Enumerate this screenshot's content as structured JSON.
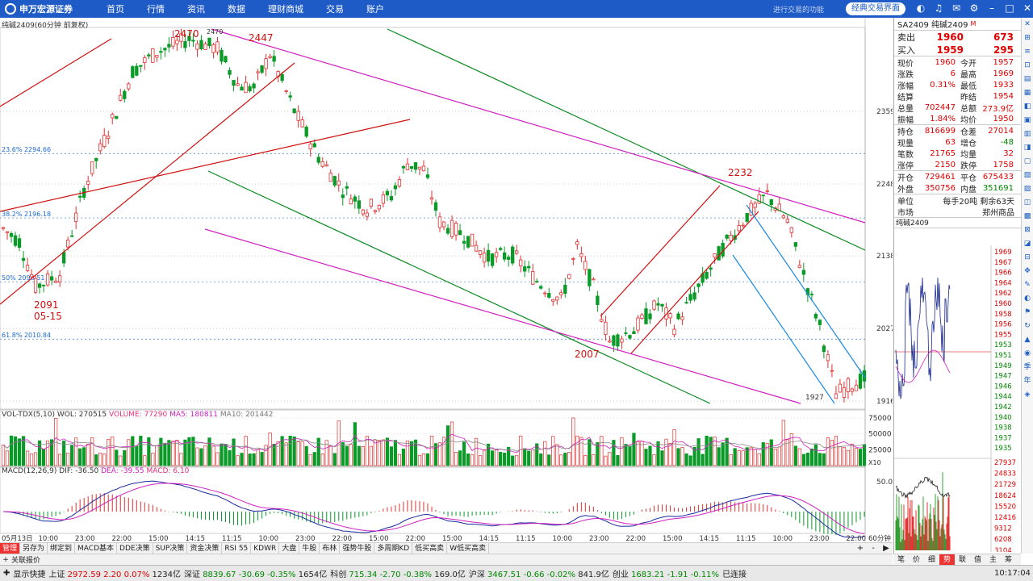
{
  "app": {
    "logo_text": "申万宏源证券"
  },
  "menu": [
    "首页",
    "行情",
    "资讯",
    "数据",
    "理财商城",
    "交易",
    "账户"
  ],
  "top_right": {
    "login_hint": "进行交易的功能",
    "classic_label": "经典交易界面"
  },
  "chart": {
    "title": "纯碱2409(60分钟 前复权)",
    "price_ticks": [
      {
        "v": 2359,
        "label": "2359"
      },
      {
        "v": 2248,
        "label": "2248"
      },
      {
        "v": 2138,
        "label": "2138"
      },
      {
        "v": 2027,
        "label": "2027"
      },
      {
        "v": 1916,
        "label": "1916"
      }
    ],
    "fib_levels": [
      {
        "v": 2294.66,
        "label": "23.6% 2294.66"
      },
      {
        "v": 2196.18,
        "label": "38.2% 2196.18"
      },
      {
        "v": 2098.51,
        "label": "50% 2098.51"
      },
      {
        "v": 2010.84,
        "label": "61.8% 2010.84"
      }
    ],
    "annotations": [
      {
        "text": "2470",
        "v": 2470,
        "i": 46
      },
      {
        "text": "2470",
        "v": 2470,
        "i": 53
      },
      {
        "text": "2447",
        "v": 2447,
        "i": 66
      },
      {
        "text": "2091",
        "v": 2091,
        "i": 8
      },
      {
        "text": "05-15",
        "v": 2091,
        "i": 8
      },
      {
        "text": "2007",
        "v": 2007,
        "i": 150
      },
      {
        "text": "2232",
        "v": 2232,
        "i": 189
      },
      {
        "text": "1927",
        "v": 1927,
        "i": 206
      }
    ],
    "time_labels": [
      "05月13日",
      "10:00",
      "23:00",
      "22:00",
      "15:00",
      "14:15",
      "11:15",
      "10:00",
      "23:00",
      "22:00",
      "15:00",
      "22:00",
      "15:00",
      "14:15",
      "11:15",
      "10:00",
      "23:00",
      "22:00",
      "15:00",
      "14:15",
      "11:15",
      "10:00",
      "23:00",
      "22:00"
    ],
    "period_label": "60分钟",
    "candles_spec": "synthetic series approximating price path",
    "vol": {
      "title": "VOL-TDX(5,10)",
      "wol": "WOL: 270515",
      "volume": "VOLUME: 77290",
      "ma5": "MA5: 180811",
      "ma10": "MA10: 201442",
      "ticks": [
        {
          "v": 75000,
          "label": "75000"
        },
        {
          "v": 50000,
          "label": "50000"
        },
        {
          "v": 25000,
          "label": "25000"
        }
      ],
      "unit_label": "X10"
    },
    "macd": {
      "title": "MACD(12,26,9)",
      "dif": "DIF: -36.50",
      "dea": "DEA: -39.55",
      "macd": "MACD: 6.10",
      "tick": "50.00"
    }
  },
  "tabs": [
    "管理",
    "另存为",
    "绑定到",
    "MACD基本",
    "DDE决策",
    "SUP决策",
    "资金决策",
    "RSI 55",
    "KDWR",
    "大盘",
    "牛股",
    "布林",
    "强势牛股",
    "多周期KD",
    "低买高卖",
    "W低买高卖"
  ],
  "quote": {
    "header": "SA2409 纯碱2409",
    "header_sub": "M",
    "sell": {
      "label": "卖出",
      "price": "1960",
      "vol": "673"
    },
    "buy": {
      "label": "买入",
      "price": "1959",
      "vol": "295"
    },
    "rows1": [
      [
        "现价",
        "1960",
        "今开",
        "1957"
      ],
      [
        "涨跌",
        "6",
        "最高",
        "1969"
      ],
      [
        "涨幅",
        "0.31%",
        "最低",
        "1933"
      ],
      [
        "结算",
        "",
        "昨结",
        "1954"
      ],
      [
        "总量",
        "702447",
        "总额",
        "273.9亿"
      ],
      [
        "振幅",
        "1.84%",
        "均价",
        "1950"
      ]
    ],
    "rows2": [
      [
        "持仓",
        "816699",
        "仓差",
        "27014"
      ],
      [
        "现量",
        "63",
        "增仓",
        "-48"
      ],
      [
        "笔数",
        "21765",
        "均量",
        "32"
      ],
      [
        "涨停",
        "2150",
        "跌停",
        "1758"
      ]
    ],
    "rows3": [
      [
        "开仓",
        "729461",
        "平仓",
        "675433"
      ],
      [
        "外盘",
        "350756",
        "内盘",
        "351691"
      ]
    ],
    "unit": {
      "label": "单位",
      "value": "每手20吨 剩余63天"
    },
    "market": {
      "label": "市场",
      "value": "郑州商品"
    },
    "mini_title": "纯碱2409",
    "mini_price_ticks": [
      "1969",
      "1967",
      "1966",
      "1964",
      "1962",
      "1960",
      "1958",
      "1956",
      "1955",
      "1953",
      "1951",
      "1949",
      "1947",
      "1946",
      "1944",
      "1942",
      "1940",
      "1938",
      "1937",
      "1935"
    ],
    "mini_vol_ticks": [
      "27937",
      "24833",
      "21729",
      "18624",
      "15520",
      "12416",
      "9312",
      "6208",
      "3104"
    ],
    "right_tabs": [
      "笔",
      "价",
      "细",
      "势",
      "联",
      "值",
      "主",
      "筹"
    ]
  },
  "sidebar_icons": [
    "✕",
    "⊞",
    "≡",
    "⊡",
    "▤",
    "▦",
    "◧",
    "▣",
    "▥",
    "◨",
    "▢",
    "▧",
    "▨",
    "◫",
    "▩",
    "⊠",
    "◪",
    "⊟",
    "✥",
    "✎",
    "◐",
    "⚑",
    "↻",
    "▲",
    "◉",
    "季",
    "年",
    "◈"
  ],
  "related_label": "关联报价",
  "status": {
    "quick": "显示快捷",
    "sh_label": "上证",
    "sh_price": "2972.59",
    "sh_chg": "2.20",
    "sh_pct": "0.07%",
    "sh_amt": "1234亿",
    "sz_label": "深证",
    "sz_price": "8839.67",
    "sz_chg": "-30.69",
    "sz_pct": "-0.35%",
    "sz_amt": "1654亿",
    "kc_label": "科创",
    "kc_price": "715.34",
    "kc_chg": "-2.70",
    "kc_pct": "-0.38%",
    "kc_amt": "169.0亿",
    "hs_label": "沪深",
    "hs_price": "3467.51",
    "hs_chg": "-0.66",
    "hs_pct": "-0.02%",
    "hs_amt": "841.9亿",
    "cy_label": "创业",
    "cy_price": "1683.21",
    "cy_chg": "-1.91",
    "cy_pct": "-0.11%",
    "cy_amt": "751.6亿",
    "conn": "已连接",
    "time": "10:17:04"
  },
  "colors": {
    "up": "#e23030",
    "down": "#0a9a28",
    "brand": "#1e5bc6"
  }
}
